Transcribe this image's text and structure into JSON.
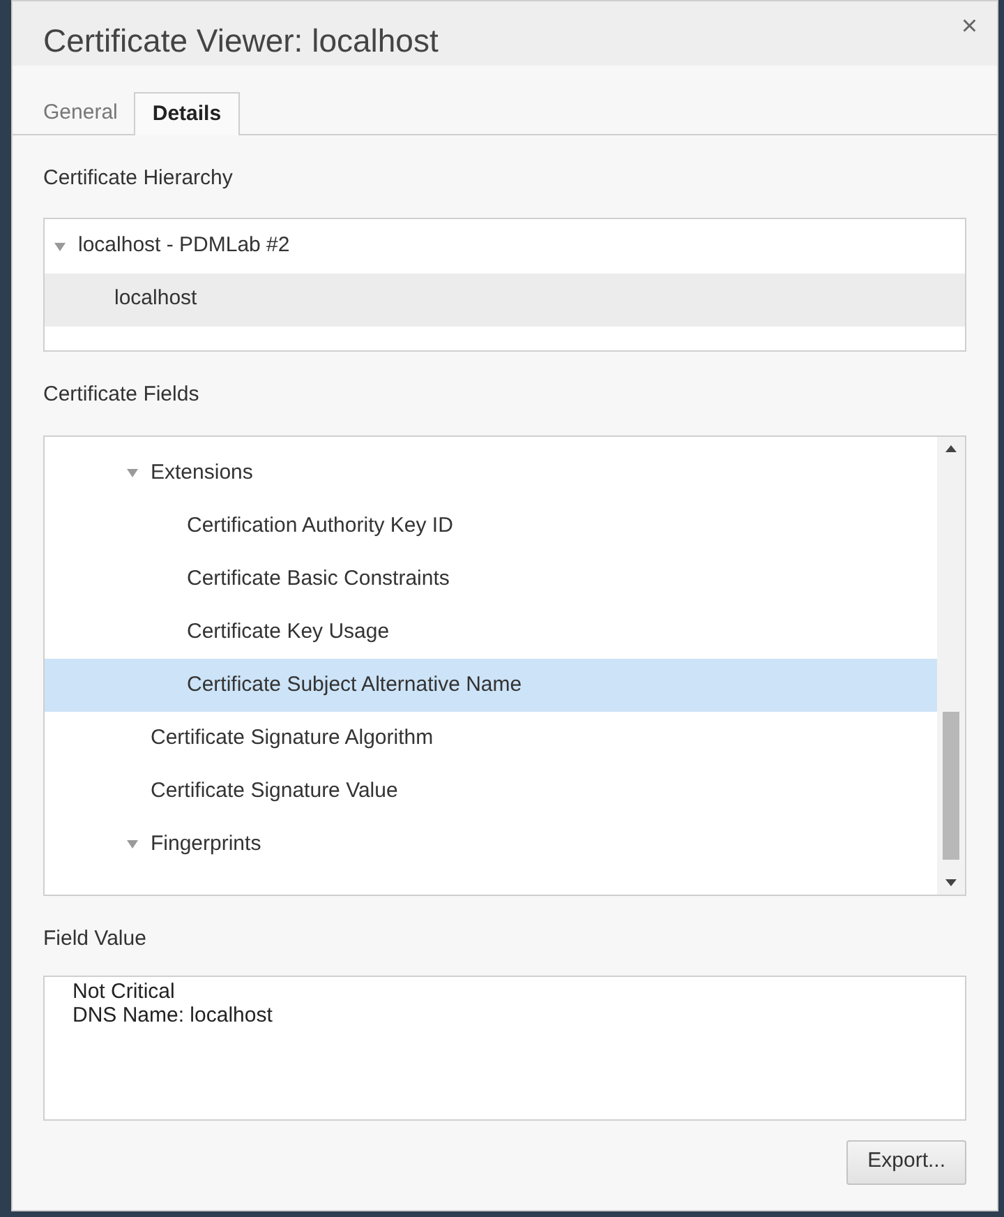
{
  "window": {
    "title": "Certificate Viewer: localhost",
    "close": "×"
  },
  "tabs": [
    {
      "label": "General",
      "selected": false
    },
    {
      "label": "Details",
      "selected": true
    }
  ],
  "hierarchy": {
    "label": "Certificate Hierarchy",
    "items": [
      {
        "label": "localhost - PDMLab #2",
        "expanded": true,
        "selected": false,
        "children": [
          {
            "label": "localhost",
            "selected": true
          }
        ]
      }
    ]
  },
  "fields": {
    "label": "Certificate Fields",
    "items": [
      {
        "label": "Extensions",
        "expanded": true,
        "selected": false,
        "children": [
          {
            "label": "Certification Authority Key ID",
            "selected": false
          },
          {
            "label": "Certificate Basic Constraints",
            "selected": false
          },
          {
            "label": "Certificate Key Usage",
            "selected": false
          },
          {
            "label": "Certificate Subject Alternative Name",
            "selected": true
          }
        ]
      },
      {
        "label": "Certificate Signature Algorithm",
        "selected": false
      },
      {
        "label": "Certificate Signature Value",
        "selected": false
      },
      {
        "label": "Fingerprints",
        "expanded": true,
        "selected": false
      }
    ]
  },
  "field_value": {
    "label": "Field Value",
    "lines": [
      "Not Critical",
      "DNS Name: localhost"
    ]
  },
  "buttons": [
    "Export..."
  ]
}
